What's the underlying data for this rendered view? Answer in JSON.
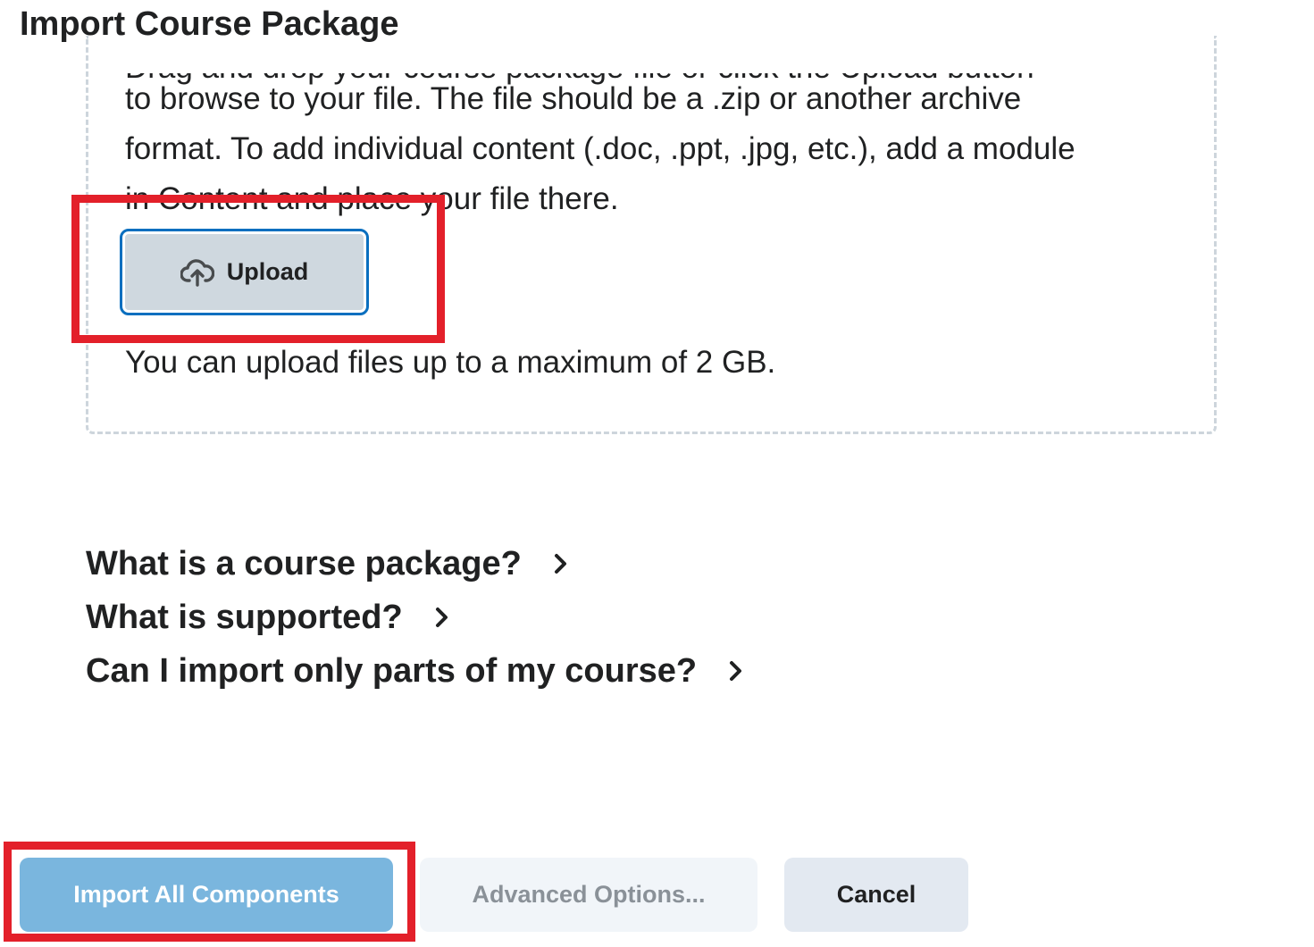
{
  "page": {
    "title": "Import Course Package"
  },
  "dropzone": {
    "partial_line": "Drag and drop your course package file or click the Upload button",
    "instruction_lines": [
      "to browse to your file. The file should be a .zip or another archive",
      "format. To add individual content (.doc, .ppt, .jpg, etc.), add a module",
      "in Content and place your file there."
    ],
    "upload_button": {
      "label": "Upload",
      "icon": "cloud-upload-icon"
    },
    "max_size_note": "You can upload files up to a maximum of 2 GB."
  },
  "help_links": [
    {
      "label": "What is a course package?",
      "icon": "chevron-right-icon"
    },
    {
      "label": "What is supported?",
      "icon": "chevron-right-icon"
    },
    {
      "label": "Can I import only parts of my course?",
      "icon": "chevron-right-icon"
    }
  ],
  "actions": {
    "import_all": "Import All Components",
    "advanced": "Advanced Options...",
    "cancel": "Cancel"
  },
  "colors": {
    "annotation": "#e3202a",
    "primary_button": "#7ab6de",
    "focus_ring": "#0a6fbf",
    "dashed_border": "#cdd5dc"
  }
}
